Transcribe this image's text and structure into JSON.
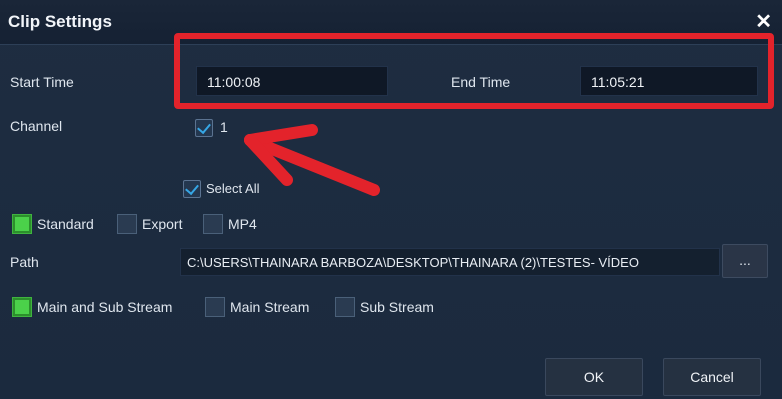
{
  "dialog": {
    "title": "Clip Settings",
    "close_glyph": "✕"
  },
  "time": {
    "start_label": "Start Time",
    "start_value": "11:00:08",
    "end_label": "End Time",
    "end_value": "11:05:21"
  },
  "channel": {
    "label": "Channel",
    "option_1": "1",
    "option_1_checked": true,
    "select_all_label": "Select All",
    "select_all_checked": true
  },
  "format": {
    "options": [
      "Standard",
      "Export",
      "MP4"
    ],
    "selected": "Standard"
  },
  "path": {
    "label": "Path",
    "value": "C:\\USERS\\THAINARA BARBOZA\\DESKTOP\\THAINARA (2)\\TESTES- VÍDEO",
    "browse_label": "..."
  },
  "stream": {
    "options": [
      "Main and Sub Stream",
      "Main Stream",
      "Sub Stream"
    ],
    "selected": "Main and Sub Stream"
  },
  "buttons": {
    "ok": "OK",
    "cancel": "Cancel"
  },
  "annotation_colors": {
    "highlight": "#e3232b"
  },
  "icons": [
    "close-icon",
    "checkmark-icon",
    "annotation-arrow"
  ]
}
